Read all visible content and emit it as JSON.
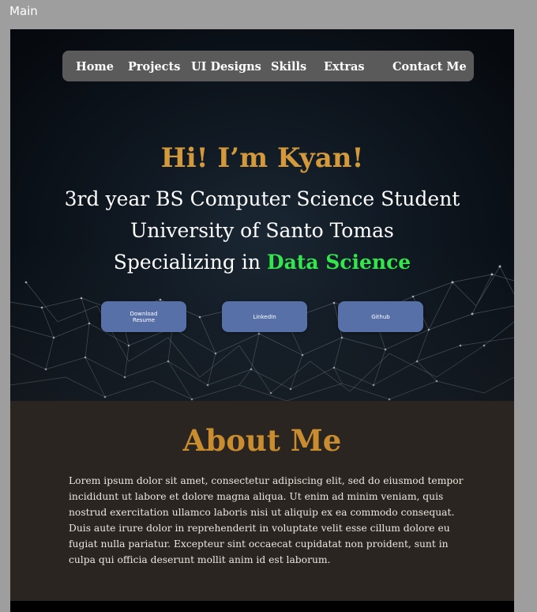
{
  "canvas": {
    "frame_label": "Main"
  },
  "nav": {
    "items": [
      {
        "label": "Home"
      },
      {
        "label": "Projects"
      },
      {
        "label": "UI Designs"
      },
      {
        "label": "Skills"
      },
      {
        "label": "Extras"
      },
      {
        "label": "Contact Me"
      }
    ]
  },
  "hero": {
    "title": "Hi! I’m Kyan!",
    "line1": "3rd year  BS Computer Science Student",
    "line2": "University of Santo Tomas",
    "line3_prefix": "Specializing in ",
    "line3_accent": "Data Science",
    "buttons": {
      "resume": "Download Resume",
      "linkedin": "LinkedIn",
      "github": "Github"
    }
  },
  "about": {
    "title": "About Me",
    "body": "Lorem ipsum dolor sit amet, consectetur adipiscing elit, sed do eiusmod tempor incididunt ut labore et dolore magna aliqua. Ut enim ad minim veniam, quis nostrud exercitation ullamco laboris nisi ut aliquip ex ea commodo consequat. Duis aute irure dolor in reprehenderit in voluptate velit esse cillum dolore eu fugiat nulla pariatur. Excepteur sint occaecat cupidatat non proident, sunt in culpa qui officia deserunt mollit anim id est laborum."
  },
  "colors": {
    "title_accent": "#d4993a",
    "green_accent": "#32e64b",
    "button": "#5870a8",
    "nav_bg": "#5a5a5a",
    "about_bg": "#2b2522"
  }
}
